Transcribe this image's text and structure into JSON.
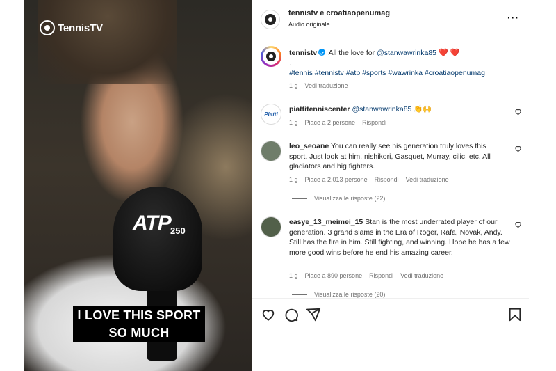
{
  "video": {
    "brand": "TennisTV",
    "mic_brand": "ATP",
    "mic_sub": "250",
    "caption_line1": "I LOVE THIS SPORT",
    "caption_line2": "SO MUCH"
  },
  "header": {
    "account": "tennistv e croatiaopenumag",
    "subtitle": "Audio originale",
    "more": "···"
  },
  "post": {
    "username": "tennistv",
    "text": "All the love for",
    "mention": "@stanwawrinka85",
    "hearts": "❤️ ❤️",
    "dot": ".",
    "hashtags": "#tennis #tennistv #atp #sports #wawrinka #croatiaopenumag",
    "time": "1 g",
    "translate": "Vedi traduzione"
  },
  "comments": [
    {
      "username": "piattitenniscenter",
      "text": "@stanwawrinka85 👏🙌",
      "time": "1 g",
      "likes": "Piace a 2 persone",
      "reply": "Rispondi"
    },
    {
      "username": "leo_seoane",
      "text": "You can really see his generation truly loves this sport. Just look at him, nishikori, Gasquet, Murray, cilic, etc. All gladiators and big fighters.",
      "time": "1 g",
      "likes": "Piace a 2.013 persone",
      "reply": "Rispondi",
      "translate": "Vedi traduzione",
      "view_replies": "Visualizza le risposte (22)"
    },
    {
      "username": "easye_13_meimei_15",
      "text": "Stan is the most underrated player of our generation. 3 grand slams in the Era of Roger, Rafa, Novak, Andy. Still has the fire in him. Still fighting, and winning. Hope he has a few more good wins before he end his amazing career.",
      "time": "1 g",
      "likes": "Piace a 890 persone",
      "reply": "Rispondi",
      "translate": "Vedi traduzione",
      "view_replies": "Visualizza le risposte (20)"
    }
  ],
  "icons": {
    "like": "heart-icon",
    "comment": "comment-icon",
    "share": "share-icon",
    "save": "bookmark-icon"
  },
  "colors": {
    "link_blue": "#00376b",
    "verified": "#0095f6",
    "meta_gray": "#737373"
  }
}
